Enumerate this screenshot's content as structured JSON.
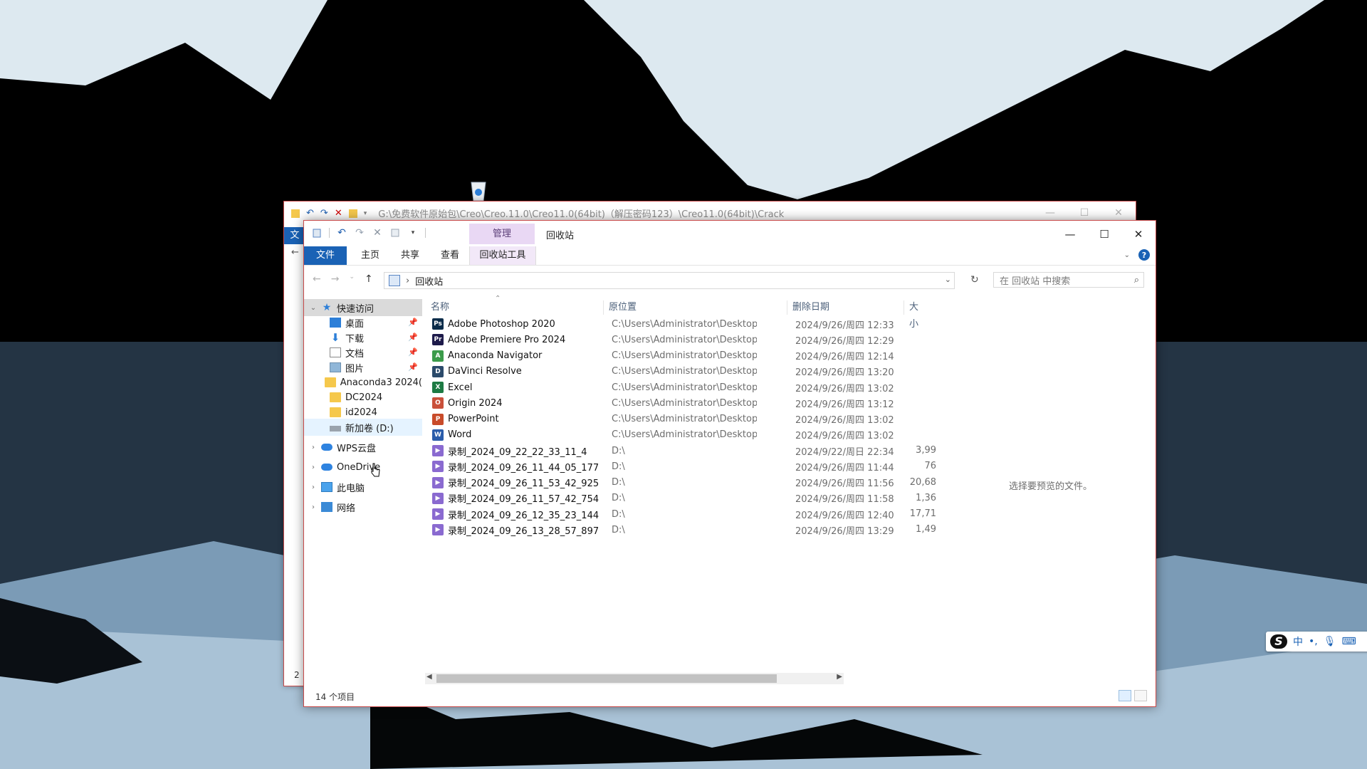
{
  "back_window": {
    "path": "G:\\免费软件原始包\\Creo\\Creo.11.0\\Creo11.0(64bit)（解压密码123）\\Creo11.0(64bit)\\Crack",
    "tab_label": "文",
    "left_num": "2"
  },
  "window": {
    "manage_tab": "管理",
    "title": "回收站",
    "caption": {
      "minimize": "—",
      "maximize": "☐",
      "close": "✕"
    }
  },
  "ribbon": {
    "tabs": [
      "文件",
      "主页",
      "共享",
      "查看",
      "回收站工具"
    ]
  },
  "address": {
    "current": "回收站",
    "search_placeholder": "在 回收站 中搜索"
  },
  "nav_pane": {
    "quick_access": "快速访问",
    "pinned": [
      "桌面",
      "下载",
      "文档",
      "图片"
    ],
    "folders": [
      "Anaconda3 2024(",
      "DC2024",
      "id2024",
      "新加卷 (D:)"
    ],
    "roots": [
      "WPS云盘",
      "OneDrive",
      "此电脑",
      "网络"
    ]
  },
  "columns": {
    "name": "名称",
    "location": "原位置",
    "date": "删除日期",
    "size": "大小"
  },
  "files": [
    {
      "name": "Adobe Photoshop 2020",
      "location": "C:\\Users\\Administrator\\Desktop",
      "date": "2024/9/26/周四 12:33",
      "size": "",
      "icon": "photoshop-icon",
      "color": "#0b2c4a",
      "glyph": "Ps"
    },
    {
      "name": "Adobe Premiere Pro 2024",
      "location": "C:\\Users\\Administrator\\Desktop",
      "date": "2024/9/26/周四 12:29",
      "size": "",
      "icon": "premiere-icon",
      "color": "#1d1a4a",
      "glyph": "Pr"
    },
    {
      "name": "Anaconda Navigator",
      "location": "C:\\Users\\Administrator\\Desktop",
      "date": "2024/9/26/周四 12:14",
      "size": "",
      "icon": "anaconda-icon",
      "color": "#3b9b4a",
      "glyph": "A"
    },
    {
      "name": "DaVinci Resolve",
      "location": "C:\\Users\\Administrator\\Desktop",
      "date": "2024/9/26/周四 13:20",
      "size": "",
      "icon": "davinci-icon",
      "color": "#2b4a6a",
      "glyph": "D"
    },
    {
      "name": "Excel",
      "location": "C:\\Users\\Administrator\\Desktop",
      "date": "2024/9/26/周四 13:02",
      "size": "",
      "icon": "excel-icon",
      "color": "#1d7a43",
      "glyph": "X"
    },
    {
      "name": "Origin 2024",
      "location": "C:\\Users\\Administrator\\Desktop",
      "date": "2024/9/26/周四 13:12",
      "size": "",
      "icon": "origin-icon",
      "color": "#c9503a",
      "glyph": "O"
    },
    {
      "name": "PowerPoint",
      "location": "C:\\Users\\Administrator\\Desktop",
      "date": "2024/9/26/周四 13:02",
      "size": "",
      "icon": "powerpoint-icon",
      "color": "#c84b2a",
      "glyph": "P"
    },
    {
      "name": "Word",
      "location": "C:\\Users\\Administrator\\Desktop",
      "date": "2024/9/26/周四 13:02",
      "size": "",
      "icon": "word-icon",
      "color": "#2a5caa",
      "glyph": "W"
    },
    {
      "name": "录制_2024_09_22_22_33_11_4",
      "location": "D:\\",
      "date": "2024/9/22/周日 22:34",
      "size": "3,99",
      "icon": "video-file-icon",
      "color": "#8a6ad0",
      "glyph": "▶"
    },
    {
      "name": "录制_2024_09_26_11_44_05_177",
      "location": "D:\\",
      "date": "2024/9/26/周四 11:44",
      "size": "76",
      "icon": "video-file-icon",
      "color": "#8a6ad0",
      "glyph": "▶"
    },
    {
      "name": "录制_2024_09_26_11_53_42_925",
      "location": "D:\\",
      "date": "2024/9/26/周四 11:56",
      "size": "20,68",
      "icon": "video-file-icon",
      "color": "#8a6ad0",
      "glyph": "▶"
    },
    {
      "name": "录制_2024_09_26_11_57_42_754",
      "location": "D:\\",
      "date": "2024/9/26/周四 11:58",
      "size": "1,36",
      "icon": "video-file-icon",
      "color": "#8a6ad0",
      "glyph": "▶"
    },
    {
      "name": "录制_2024_09_26_12_35_23_144",
      "location": "D:\\",
      "date": "2024/9/26/周四 12:40",
      "size": "17,71",
      "icon": "video-file-icon",
      "color": "#8a6ad0",
      "glyph": "▶"
    },
    {
      "name": "录制_2024_09_26_13_28_57_897",
      "location": "D:\\",
      "date": "2024/9/26/周四 13:29",
      "size": "1,49",
      "icon": "video-file-icon",
      "color": "#8a6ad0",
      "glyph": "▶"
    }
  ],
  "preview_text": "选择要预览的文件。",
  "status": "14 个项目",
  "ime": {
    "mode": "中"
  }
}
